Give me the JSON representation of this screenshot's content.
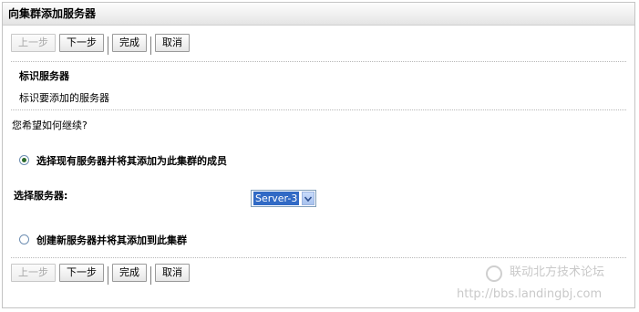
{
  "window": {
    "title": "向集群添加服务器"
  },
  "toolbar": {
    "prev_label": "上一步",
    "next_label": "下一步",
    "finish_label": "完成",
    "cancel_label": "取消"
  },
  "step": {
    "heading": "标识服务器",
    "description": "标识要添加的服务器"
  },
  "question": "您希望如何继续?",
  "options": [
    {
      "label": "选择现有服务器并将其添加为此集群的成员",
      "selected": true
    },
    {
      "label": "创建新服务器并将其添加到此集群",
      "selected": false
    }
  ],
  "server_select": {
    "label": "选择服务器:",
    "value": "Server-3"
  },
  "watermark": {
    "text": "联动北方技术论坛",
    "url": "http://bbs.landingbj.com"
  }
}
